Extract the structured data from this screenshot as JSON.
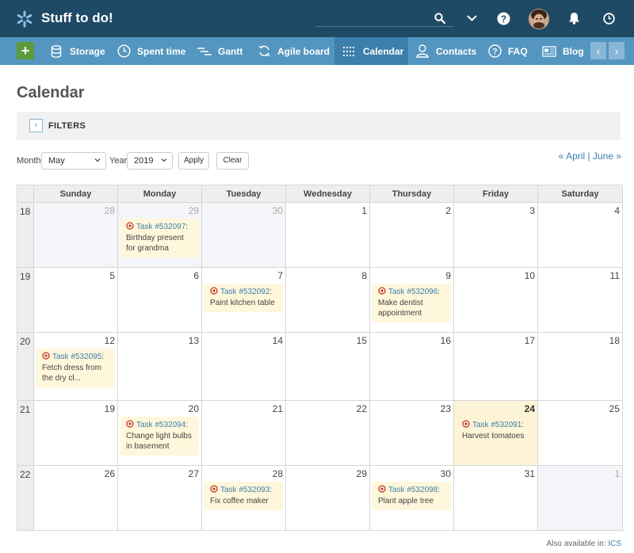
{
  "app": {
    "title": "Stuff to do!",
    "logo_icon": "snowflake-icon",
    "header_color": "#1f4a66",
    "menu_color": "#5596c0",
    "active_menu_color": "#3d7fab"
  },
  "header_icons": [
    "search-icon",
    "chevron-down-icon",
    "help-icon",
    "bell-icon",
    "clock-icon"
  ],
  "menu": {
    "items": [
      {
        "label": "Storage",
        "icon": "database-icon"
      },
      {
        "label": "Spent time",
        "icon": "clock-icon"
      },
      {
        "label": "Gantt",
        "icon": "gantt-icon"
      },
      {
        "label": "Agile board",
        "icon": "refresh-icon"
      },
      {
        "label": "Calendar",
        "icon": "calendar-icon",
        "active": true
      },
      {
        "label": "Contacts",
        "icon": "person-icon"
      },
      {
        "label": "FAQ",
        "icon": "question-icon"
      },
      {
        "label": "Blog",
        "icon": "newspaper-icon"
      }
    ]
  },
  "page": {
    "title": "Calendar",
    "filters_label": "FILTERS"
  },
  "form": {
    "month_label": "Month",
    "month_value": "May",
    "year_label": "Year",
    "year_value": "2019",
    "apply_label": "Apply",
    "clear_label": "Clear"
  },
  "nav": {
    "prev": "« April",
    "separator": "|",
    "next": "June »"
  },
  "calendar": {
    "weekdays": [
      "Sunday",
      "Monday",
      "Tuesday",
      "Wednesday",
      "Thursday",
      "Friday",
      "Saturday"
    ],
    "weeks": [
      {
        "week": "18",
        "days": [
          {
            "day": "28",
            "other": true
          },
          {
            "day": "29",
            "other": true,
            "task": {
              "link": "Task #532097",
              "text": "Birthday present for grandma"
            }
          },
          {
            "day": "30",
            "other": true
          },
          {
            "day": "1"
          },
          {
            "day": "2"
          },
          {
            "day": "3"
          },
          {
            "day": "4"
          }
        ]
      },
      {
        "week": "19",
        "days": [
          {
            "day": "5"
          },
          {
            "day": "6"
          },
          {
            "day": "7",
            "task": {
              "link": "Task #532092",
              "text": "Paint kitchen table"
            }
          },
          {
            "day": "8"
          },
          {
            "day": "9",
            "task": {
              "link": "Task #532096",
              "text": "Make dentist appointment"
            }
          },
          {
            "day": "10"
          },
          {
            "day": "11"
          }
        ]
      },
      {
        "week": "20",
        "days": [
          {
            "day": "12",
            "task": {
              "link": "Task #532095",
              "text": "Fetch dress from the dry cl..."
            }
          },
          {
            "day": "13"
          },
          {
            "day": "14"
          },
          {
            "day": "15"
          },
          {
            "day": "16"
          },
          {
            "day": "17"
          },
          {
            "day": "18"
          }
        ]
      },
      {
        "week": "21",
        "days": [
          {
            "day": "19"
          },
          {
            "day": "20",
            "task": {
              "link": "Task #532094",
              "text": "Change light bulbs in basement"
            }
          },
          {
            "day": "21"
          },
          {
            "day": "22"
          },
          {
            "day": "23"
          },
          {
            "day": "24",
            "today": true,
            "task": {
              "link": "Task #532091",
              "text": "Harvest tomatoes"
            }
          },
          {
            "day": "25"
          }
        ]
      },
      {
        "week": "22",
        "days": [
          {
            "day": "26"
          },
          {
            "day": "27"
          },
          {
            "day": "28",
            "task": {
              "link": "Task #532093",
              "text": "Fix coffee maker"
            }
          },
          {
            "day": "29"
          },
          {
            "day": "30",
            "task": {
              "link": "Task #532098",
              "text": "Plant apple tree"
            }
          },
          {
            "day": "31"
          },
          {
            "day": "1",
            "other": true
          }
        ]
      }
    ]
  },
  "footer": {
    "text": "Also available in:",
    "link": "ICS"
  }
}
